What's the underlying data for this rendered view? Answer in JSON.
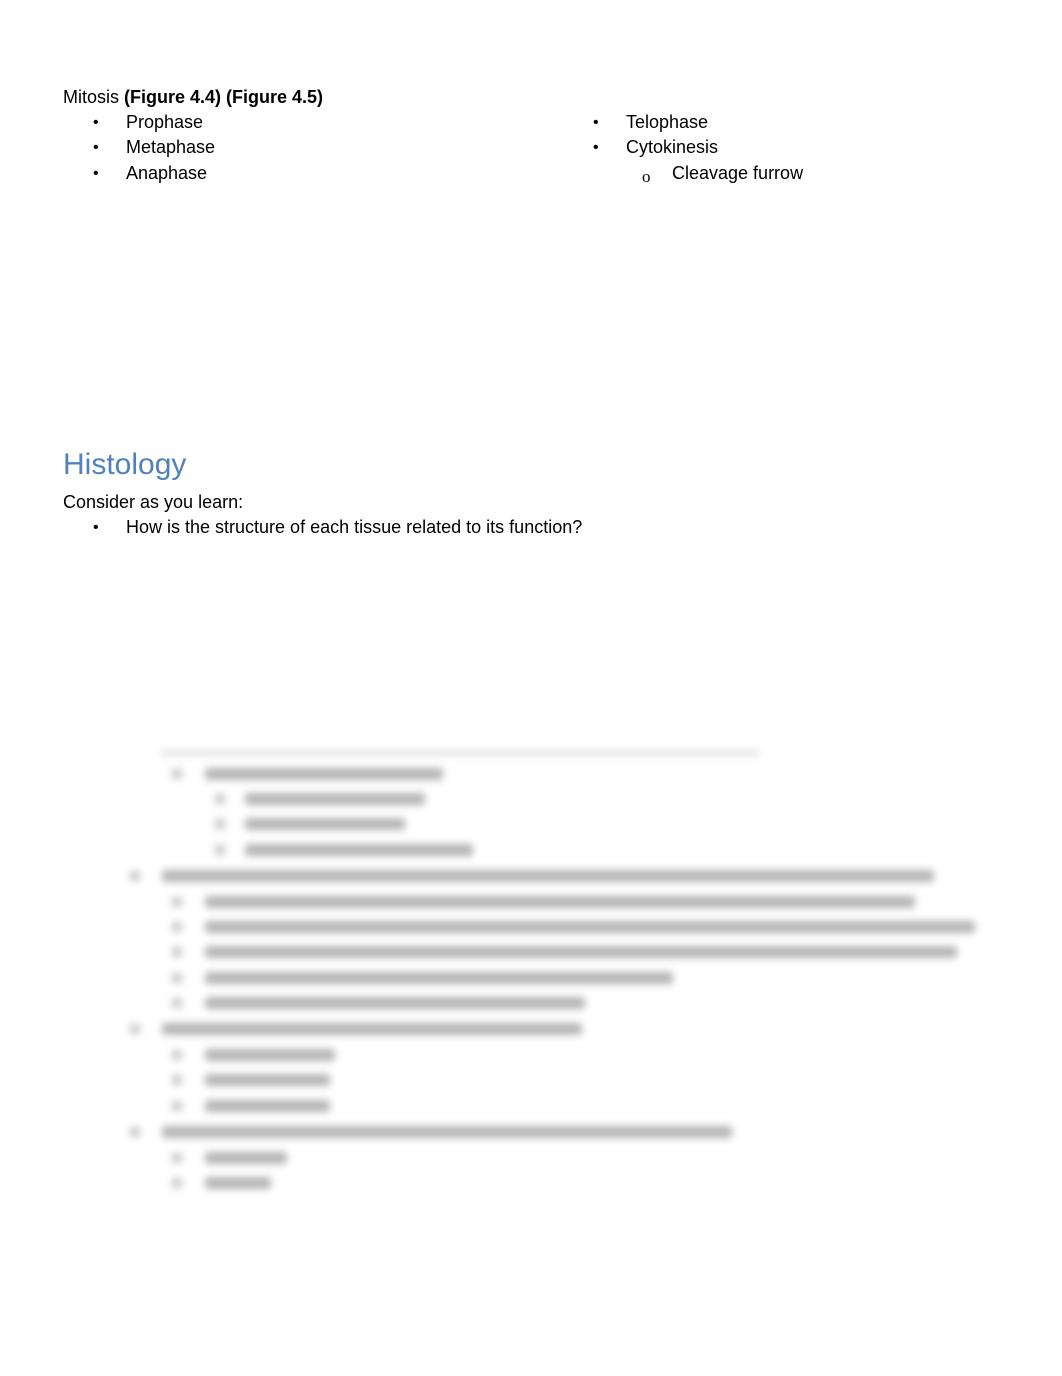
{
  "mitosis": {
    "label": "Mitosis ",
    "figures": "(Figure 4.4) (Figure 4.5)",
    "left_items": [
      "Prophase",
      "Metaphase",
      "Anaphase"
    ],
    "right_items": [
      "Telophase",
      "Cytokinesis"
    ],
    "sub_items": [
      "Cleavage furrow"
    ],
    "bullet": "•",
    "sub_bullet": "o"
  },
  "histology": {
    "heading": "Histology",
    "intro": "Consider as you learn:",
    "items": [
      "How is the structure of each tissue related to its function?"
    ],
    "bullet": "•",
    "colors": {
      "heading": "#4f81bd"
    }
  },
  "obscured_section": {
    "note": "Remaining content is blurred and unreadable"
  }
}
